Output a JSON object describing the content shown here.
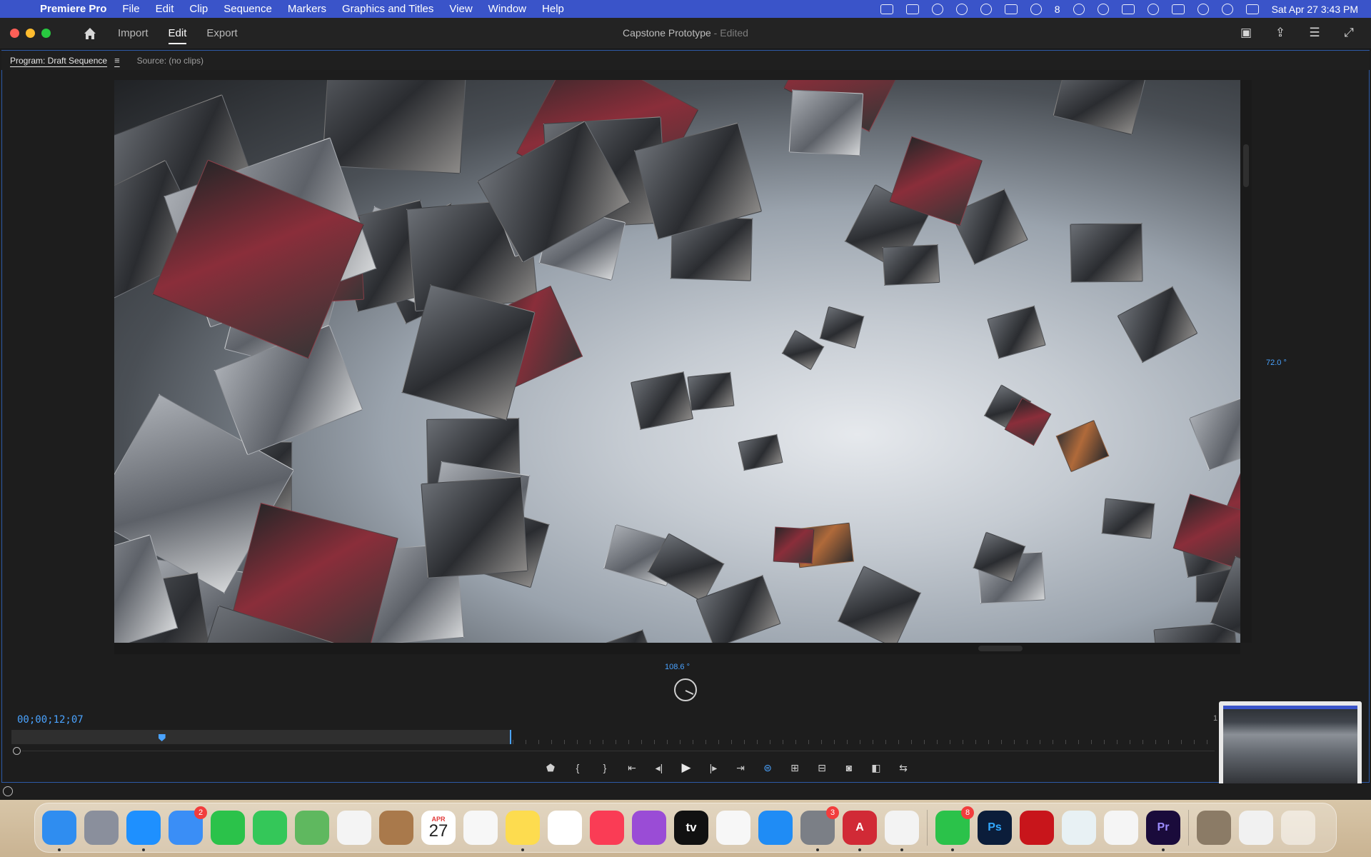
{
  "menubar": {
    "app_name": "Premiere Pro",
    "menus": [
      "File",
      "Edit",
      "Clip",
      "Sequence",
      "Markers",
      "Graphics and Titles",
      "View",
      "Window",
      "Help"
    ],
    "wechat_count": "8",
    "datetime": "Sat Apr 27  3:43 PM"
  },
  "titlebar": {
    "tabs": [
      "Import",
      "Edit",
      "Export"
    ],
    "active_tab": "Edit",
    "project": "Capstone Prototype",
    "status": " - Edited"
  },
  "panels": {
    "program_tab": "Program: Draft Sequence",
    "source_tab": "Source: (no clips)"
  },
  "monitor": {
    "pitch_angle": "72.0 °",
    "yaw_angle": "108.6 °",
    "timecode": "00;00;12;07",
    "ruler_end": "1",
    "playhead_position": 0.125,
    "in_out_end": 0.415
  },
  "colors": {
    "accent_blue": "#4aa3ff",
    "menubar": "#3a54c9",
    "panel_bg": "#1d1d1d"
  },
  "dock": {
    "mail_badge": "2",
    "settings_badge": "3",
    "wechat_badge": "8",
    "calendar_month": "APR",
    "calendar_day": "27",
    "tv_label": "tv",
    "photoshop_label": "Ps",
    "premiere_label": "Pr",
    "autocad_label": "A"
  }
}
